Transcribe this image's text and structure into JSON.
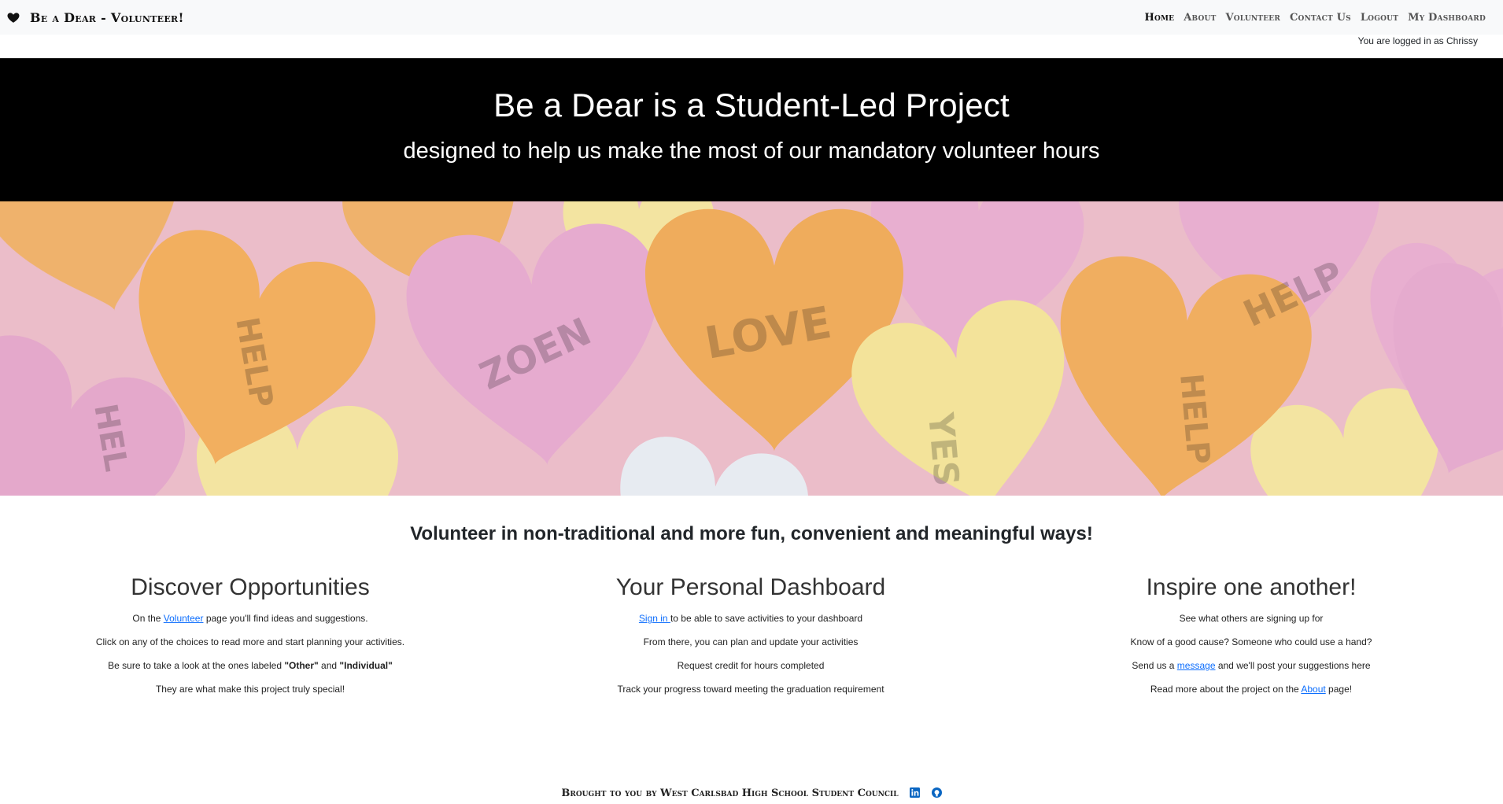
{
  "navbar": {
    "brand": "Be a Dear - Volunteer!",
    "links": [
      "Home",
      "About",
      "Volunteer",
      "Contact Us",
      "Logout",
      "My Dashboard"
    ]
  },
  "login_status": "You are logged in as Chrissy",
  "hero": {
    "title": "Be a Dear is a Student-Led Project",
    "subtitle": "designed to help us make the most of our mandatory volunteer hours"
  },
  "tagline": "Volunteer in non-traditional and more fun, convenient and meaningful ways!",
  "columns": {
    "discover": {
      "heading": "Discover Opportunities",
      "line1_pre": "On the ",
      "line1_link": "Volunteer",
      "line1_post": " page you'll find ideas and suggestions.",
      "line2": "Click on any of the choices to read more and start planning your activities.",
      "line3_pre": "Be sure to take a look at the ones labeled ",
      "line3_b1": "\"Other\"",
      "line3_mid": " and ",
      "line3_b2": "\"Individual\"",
      "line4": "They are what make this project truly special!"
    },
    "dashboard": {
      "heading": "Your Personal Dashboard",
      "line1_link": "Sign in ",
      "line1_post": "to be able to save activities to your dashboard",
      "line2": "From there, you can plan and update your activities",
      "line3": "Request credit for hours completed",
      "line4": "Track your progress toward meeting the graduation requirement"
    },
    "inspire": {
      "heading": "Inspire one another!",
      "line1": "See what others are signing up for",
      "line2": "Know of a good cause? Someone who could use a hand?",
      "line3_pre": "Send us a ",
      "line3_link": "message",
      "line3_post": " and we'll post your suggestions here",
      "line4_pre": "Read more about the project on the ",
      "line4_link": "About",
      "line4_post": " page!"
    }
  },
  "banner": {
    "heart_words": [
      "HELP",
      "LOVE",
      "ZOEN",
      "HELP",
      "YES",
      "HELP",
      "HEL"
    ]
  },
  "footer": {
    "text": "Brought to you by West Carlsbad High School Student Council",
    "icons": [
      "linkedin-icon",
      "github-icon"
    ]
  },
  "colors": {
    "navbar_bg": "#f8f9fa",
    "hero_bg": "#000000",
    "link": "#0d6efd",
    "heart_pink": "#e7a9cf",
    "heart_orange": "#f0ad5e",
    "heart_yellow": "#f4e59a"
  }
}
